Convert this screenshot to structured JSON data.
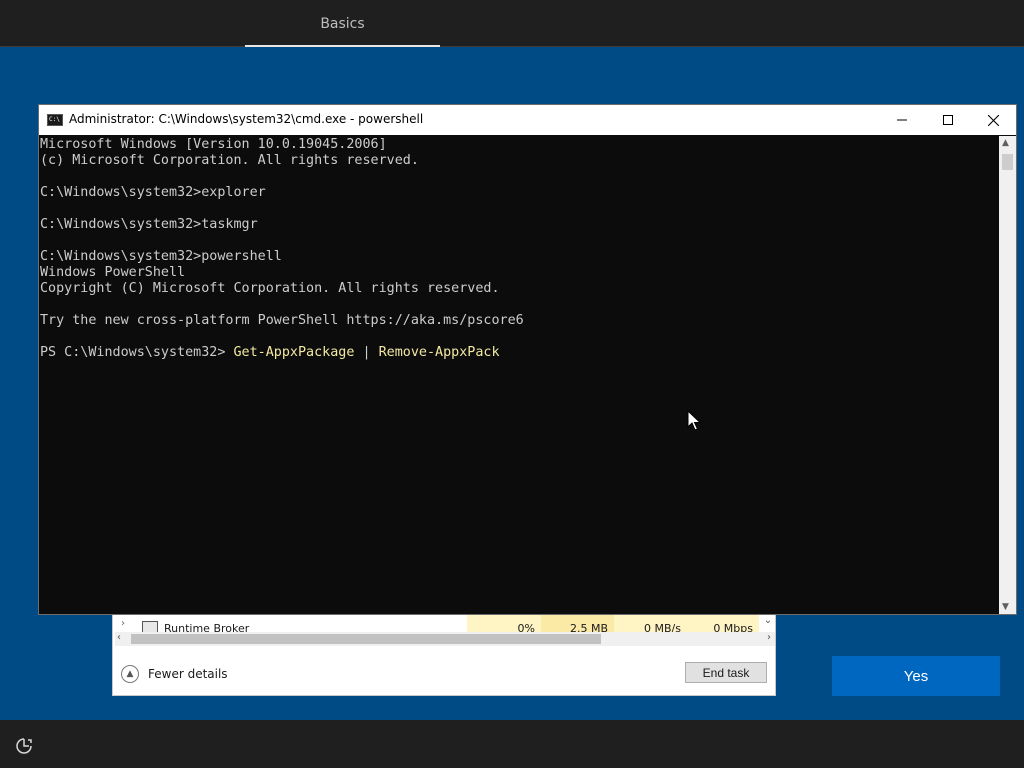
{
  "oobe": {
    "tab_label": "Basics",
    "yes_label": "Yes",
    "accessibility_icon": "accessibility-icon"
  },
  "console": {
    "title": "Administrator: C:\\Windows\\system32\\cmd.exe - powershell",
    "icon": "console-icon",
    "lines": [
      "Microsoft Windows [Version 10.0.19045.2006]",
      "(c) Microsoft Corporation. All rights reserved.",
      "",
      "C:\\Windows\\system32>explorer",
      "",
      "C:\\Windows\\system32>taskmgr",
      "",
      "C:\\Windows\\system32>powershell",
      "Windows PowerShell",
      "Copyright (C) Microsoft Corporation. All rights reserved.",
      "",
      "Try the new cross-platform PowerShell https://aka.ms/pscore6",
      ""
    ],
    "prompt": "PS C:\\Windows\\system32> ",
    "cmd_part1": "Get-AppxPackage",
    "cmd_pipe": " | ",
    "cmd_part2": "Remove-AppxPack"
  },
  "taskmgr": {
    "row": {
      "name": "Runtime Broker",
      "cpu": "0%",
      "memory": "2.5 MB",
      "disk": "0 MB/s",
      "network": "0 Mbps"
    },
    "fewer_details_label": "Fewer details",
    "end_task_label": "End task"
  }
}
